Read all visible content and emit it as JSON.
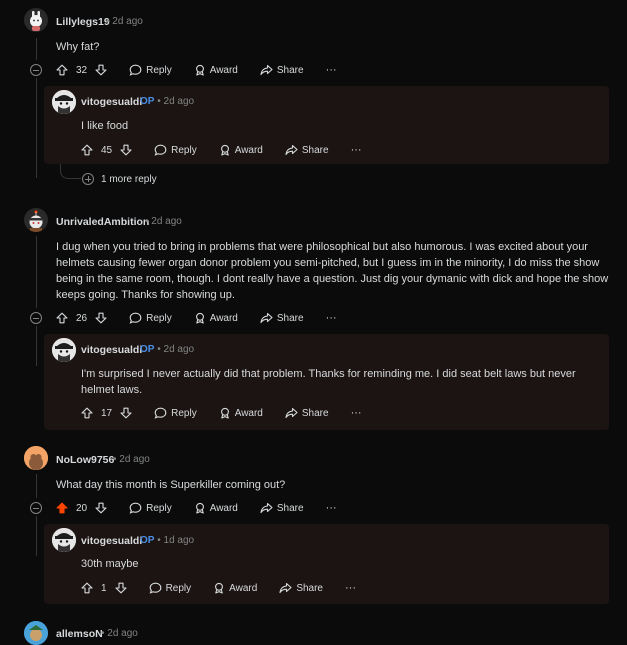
{
  "colors": {
    "background": "#0b0b0b",
    "reply_bg": "#1c1413",
    "op_badge": "#4a8fe7",
    "upvoted": "#ff4500",
    "muted": "#818384"
  },
  "actions": {
    "reply": "Reply",
    "award": "Award",
    "share": "Share",
    "more": "···"
  },
  "comments": [
    {
      "user": "Lillylegs19",
      "time": "2d ago",
      "text": "Why fat?",
      "score": "32",
      "reply": {
        "user": "vitogesualdi",
        "badge": "OP",
        "time": "2d ago",
        "text": "I like food",
        "score": "45"
      },
      "more_replies": "1 more reply"
    },
    {
      "user": "UnrivaledAmbition",
      "time": "2d ago",
      "text": "I dug when you tried to bring in problems that were philosophical but also humorous. I was excited about your helmets causing fewer organ donor problem you semi-pitched, but I guess im in the minority, I do miss the show being in the same room, though. I dont really have a question. Just dig your dymanic with dick and hope the show keeps going. Thanks for showing up.",
      "score": "26",
      "reply": {
        "user": "vitogesualdi",
        "badge": "OP",
        "time": "2d ago",
        "text": "I'm surprised I never actually did that problem. Thanks for reminding me. I did seat belt laws but never helmet laws.",
        "score": "17"
      }
    },
    {
      "user": "NoLow9756",
      "time": "2d ago",
      "text": "What day this month is Superkiller coming out?",
      "score": "20",
      "reply": {
        "user": "vitogesualdi",
        "badge": "OP",
        "time": "1d ago",
        "text": "30th maybe",
        "score": "1"
      }
    },
    {
      "user": "allemsoN",
      "time": "2d ago"
    }
  ]
}
